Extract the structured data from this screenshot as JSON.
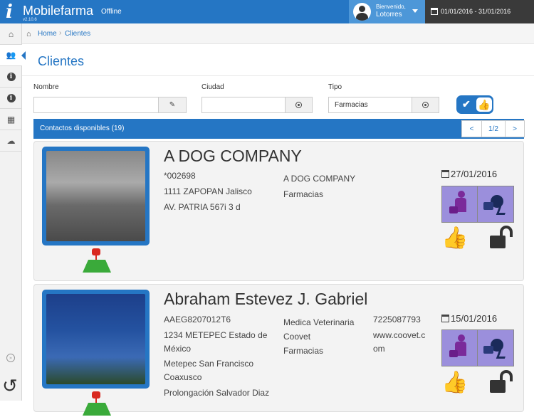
{
  "app": {
    "logo_letter": "i",
    "name": "Mobilefarma",
    "status": "Offline",
    "version": "v2.10.6"
  },
  "user": {
    "welcome": "Bienvenido,",
    "name": "Lotorres"
  },
  "date_range": "01/01/2016 - 31/01/2016",
  "sidebar": {
    "items": [
      {
        "name": "home-icon",
        "glyph": "⌂"
      },
      {
        "name": "users-icon",
        "glyph": "👥"
      },
      {
        "name": "info-icon",
        "glyph": "i"
      },
      {
        "name": "info-icon",
        "glyph": "i"
      },
      {
        "name": "calendar-icon",
        "glyph": "▦"
      },
      {
        "name": "cloud-upload-icon",
        "glyph": "☁"
      }
    ],
    "collapse_glyph": "»",
    "refresh_glyph": "↺"
  },
  "breadcrumb": {
    "home": "Home",
    "separator": "›",
    "current": "Clientes"
  },
  "page_title": "Clientes",
  "filters": {
    "nombre_label": "Nombre",
    "nombre_value": "",
    "ciudad_label": "Ciudad",
    "ciudad_value": "",
    "tipo_label": "Tipo",
    "tipo_value": "Farmacias",
    "edit_glyph": "✎",
    "toggle_check": "✔",
    "toggle_like": "👍"
  },
  "results": {
    "label": "Contactos disponibles (19)",
    "pager_prev": "<",
    "pager_page": "1/2",
    "pager_next": ">"
  },
  "clients": [
    {
      "name": "A DOG COMPANY",
      "code": "*002698",
      "address1": "1111 ZAPOPAN Jalisco",
      "address2": "AV. PATRIA 567i 3 d",
      "business_name": "A DOG COMPANY",
      "type": "Farmacias",
      "date": "27/01/2016"
    },
    {
      "name": "Abraham Estevez J. Gabriel",
      "code": "AAEG8207012T6",
      "address1": "1234 METEPEC Estado de",
      "address1b": "México",
      "address2": "Metepec San Francisco",
      "address2b": "Coaxusco",
      "address3": "Prolongación Salvador Diaz",
      "business_name": "Medica Veterinaria",
      "business_name_b": "Coovet",
      "type": "Farmacias",
      "phone": "7225087793",
      "web": "www.coovet.c",
      "web_b": "om",
      "date": "15/01/2016"
    }
  ],
  "colors": {
    "primary": "#2576c4",
    "status_bg": "#9b8fdc"
  }
}
